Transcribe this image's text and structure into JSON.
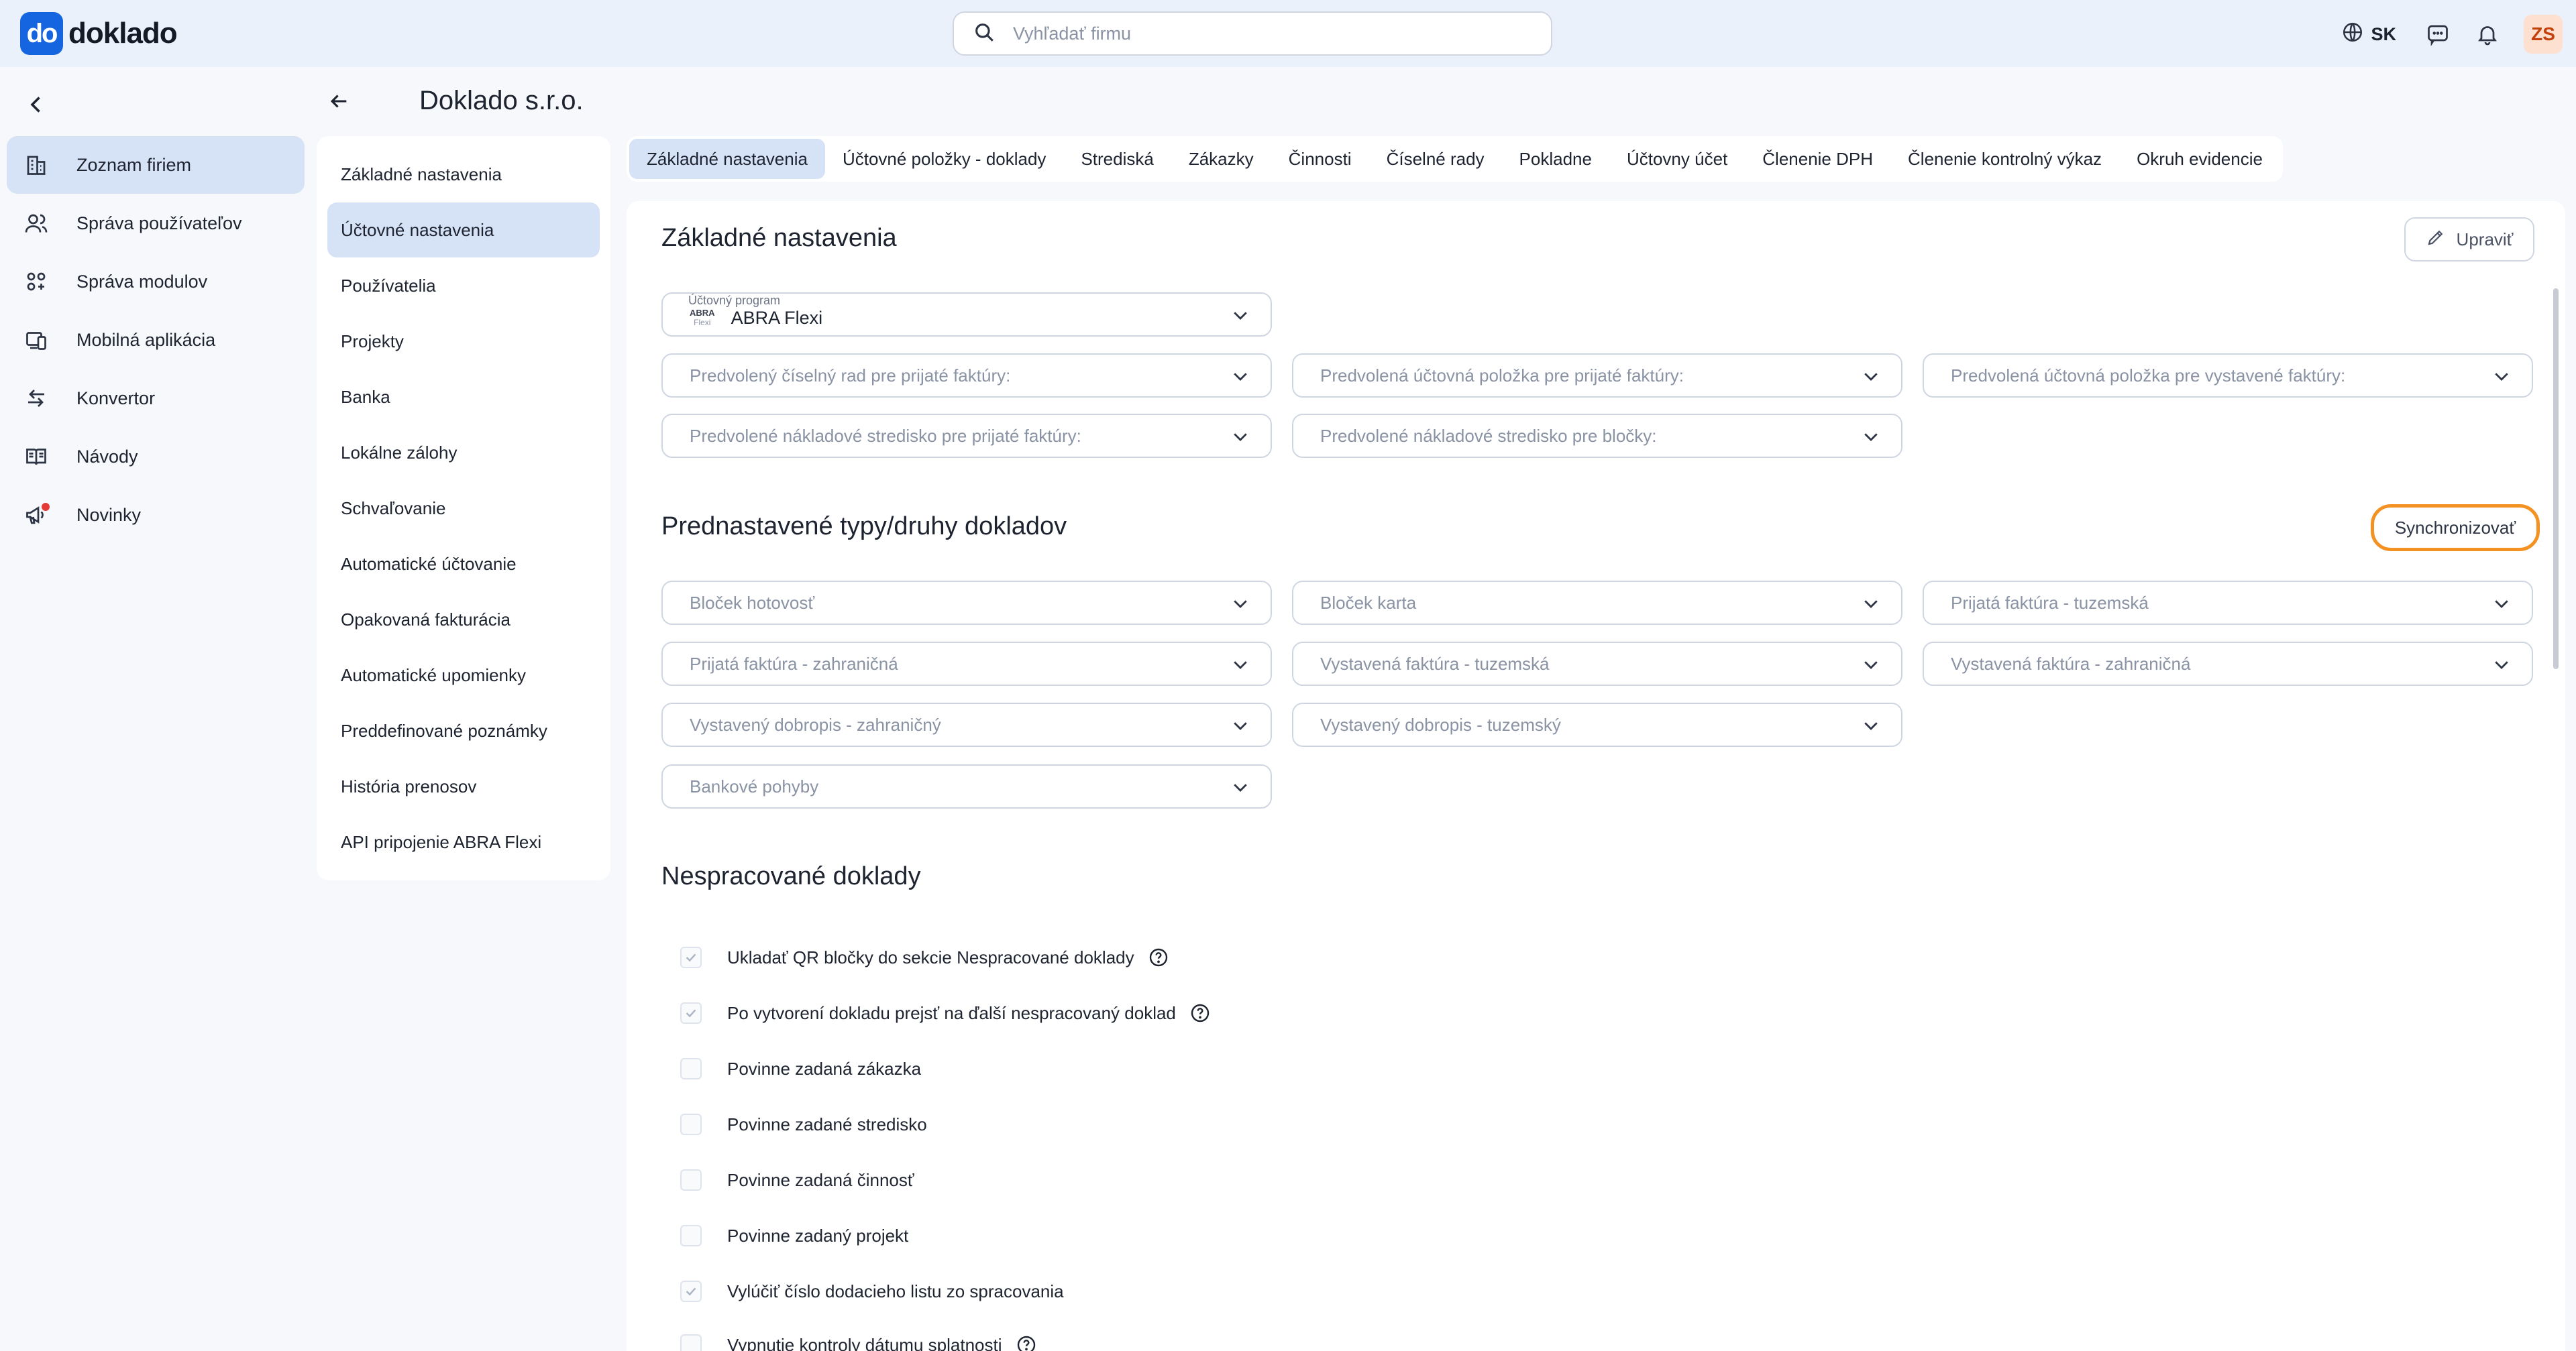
{
  "brand": {
    "logo_mark": "do",
    "logo_text": "doklado"
  },
  "search": {
    "placeholder": "Vyhľadať firmu",
    "value": ""
  },
  "topbar": {
    "language": "SK",
    "avatar_initials": "ZS"
  },
  "leftnav": {
    "items": [
      {
        "label": "Zoznam firiem",
        "icon": "building-icon",
        "active": true
      },
      {
        "label": "Správa používateľov",
        "icon": "users-icon"
      },
      {
        "label": "Správa modulov",
        "icon": "modules-icon"
      },
      {
        "label": "Mobilná aplikácia",
        "icon": "mobile-icon"
      },
      {
        "label": "Konvertor",
        "icon": "convert-icon"
      },
      {
        "label": "Návody",
        "icon": "book-icon"
      },
      {
        "label": "Novinky",
        "icon": "megaphone-icon"
      }
    ]
  },
  "page": {
    "title": "Doklado s.r.o."
  },
  "submenu": {
    "items": [
      {
        "label": "Základné nastavenia"
      },
      {
        "label": "Účtovné nastavenia",
        "active": true
      },
      {
        "label": "Používatelia"
      },
      {
        "label": "Projekty"
      },
      {
        "label": "Banka"
      },
      {
        "label": "Lokálne zálohy"
      },
      {
        "label": "Schvaľovanie"
      },
      {
        "label": "Automatické účtovanie"
      },
      {
        "label": "Opakovaná fakturácia"
      },
      {
        "label": "Automatické upomienky"
      },
      {
        "label": "Preddefinované poznámky"
      },
      {
        "label": "História prenosov"
      },
      {
        "label": "API pripojenie ABRA Flexi"
      }
    ]
  },
  "tabs": [
    {
      "label": "Základné nastavenia",
      "active": true
    },
    {
      "label": "Účtovné položky - doklady"
    },
    {
      "label": "Strediská"
    },
    {
      "label": "Zákazky"
    },
    {
      "label": "Činnosti"
    },
    {
      "label": "Číselné rady"
    },
    {
      "label": "Pokladne"
    },
    {
      "label": "Účtovny účet"
    },
    {
      "label": "Členenie DPH"
    },
    {
      "label": "Členenie kontrolný výkaz"
    },
    {
      "label": "Okruh evidencie"
    }
  ],
  "basic": {
    "title": "Základné nastavenia",
    "edit_label": "Upraviť",
    "program_label": "Účtovný program",
    "program_logo_top": "ABRA",
    "program_logo_bottom": "Flexi",
    "program_value": "ABRA Flexi",
    "selects": [
      "Predvolený číselný rad pre prijaté faktúry:",
      "Predvolená účtovná položka pre prijaté faktúry:",
      "Predvolená účtovná položka pre vystavené faktúry:",
      "Predvolené nákladové stredisko pre prijaté faktúry:",
      "Predvolené nákladové stredisko pre bločky:"
    ]
  },
  "types": {
    "title": "Prednastavené typy/druhy dokladov",
    "sync_label": "Synchronizovať",
    "selects": [
      "Bloček hotovosť",
      "Bloček karta",
      "Prijatá faktúra - tuzemská",
      "Prijatá faktúra - zahraničná",
      "Vystavená faktúra - tuzemská",
      "Vystavená faktúra - zahraničná",
      "Vystavený dobropis - zahraničný",
      "Vystavený dobropis - tuzemský",
      "Bankové pohyby"
    ]
  },
  "unprocessed": {
    "title": "Nespracované doklady",
    "checks": [
      {
        "label": "Ukladať QR bločky do sekcie Nespracované doklady",
        "checked": true,
        "help": true
      },
      {
        "label": "Po vytvorení dokladu prejsť na ďalší nespracovaný doklad",
        "checked": true,
        "help": true
      },
      {
        "label": "Povinne zadaná zákazka",
        "checked": false
      },
      {
        "label": "Povinne zadané stredisko",
        "checked": false
      },
      {
        "label": "Povinne zadaná činnosť",
        "checked": false
      },
      {
        "label": "Povinne zadaný projekt",
        "checked": false
      },
      {
        "label": "Vylúčiť číslo dodacieho listu zo spracovania",
        "checked": true
      },
      {
        "label": "Vypnutie kontroly dátumu splatnosti",
        "checked": false,
        "help": true
      }
    ]
  },
  "colors": {
    "primary": "#1565e0",
    "active_bg": "#d6e3f7",
    "sync_border": "#f39222"
  }
}
